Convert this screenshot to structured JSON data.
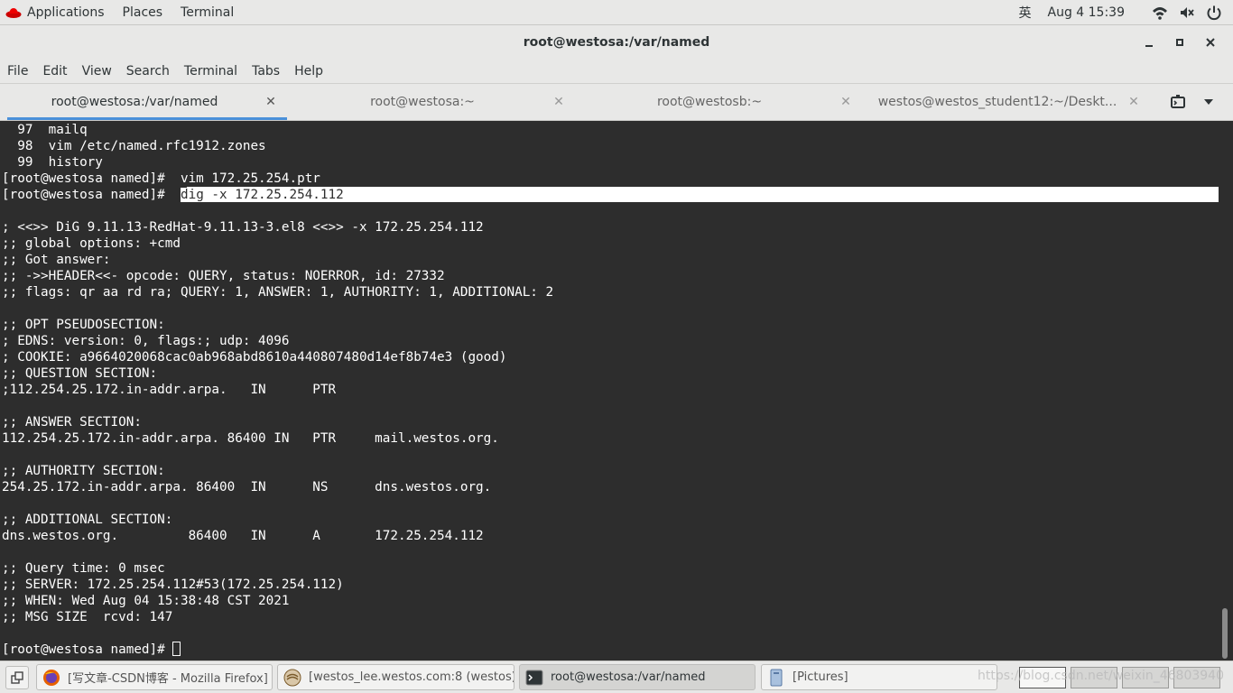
{
  "top_panel": {
    "applications": "Applications",
    "places": "Places",
    "terminal": "Terminal",
    "input_method": "英",
    "datetime": "Aug 4  15:39"
  },
  "window": {
    "title": "root@westosa:/var/named"
  },
  "menubar": {
    "items": [
      "File",
      "Edit",
      "View",
      "Search",
      "Terminal",
      "Tabs",
      "Help"
    ]
  },
  "tabs": [
    {
      "label": "root@westosa:/var/named",
      "active": true
    },
    {
      "label": "root@westosa:~",
      "active": false
    },
    {
      "label": "root@westosb:~",
      "active": false
    },
    {
      "label": "westos@westos_student12:~/Deskt...",
      "active": false
    }
  ],
  "terminal": {
    "lines": [
      "  97  mailq",
      "  98  vim /etc/named.rfc1912.zones",
      "  99  history",
      "[root@westosa named]#  vim 172.25.254.ptr",
      "[root@westosa named]#  ",
      "",
      "; <<>> DiG 9.11.13-RedHat-9.11.13-3.el8 <<>> -x 172.25.254.112",
      ";; global options: +cmd",
      ";; Got answer:",
      ";; ->>HEADER<<- opcode: QUERY, status: NOERROR, id: 27332",
      ";; flags: qr aa rd ra; QUERY: 1, ANSWER: 1, AUTHORITY: 1, ADDITIONAL: 2",
      "",
      ";; OPT PSEUDOSECTION:",
      "; EDNS: version: 0, flags:; udp: 4096",
      "; COOKIE: a9664020068cac0ab968abd8610a440807480d14ef8b74e3 (good)",
      ";; QUESTION SECTION:",
      ";112.254.25.172.in-addr.arpa.   IN      PTR",
      "",
      ";; ANSWER SECTION:",
      "112.254.25.172.in-addr.arpa. 86400 IN   PTR     mail.westos.org.",
      "",
      ";; AUTHORITY SECTION:",
      "254.25.172.in-addr.arpa. 86400  IN      NS      dns.westos.org.",
      "",
      ";; ADDITIONAL SECTION:",
      "dns.westos.org.         86400   IN      A       172.25.254.112",
      "",
      ";; Query time: 0 msec",
      ";; SERVER: 172.25.254.112#53(172.25.254.112)",
      ";; WHEN: Wed Aug 04 15:38:48 CST 2021",
      ";; MSG SIZE  rcvd: 147",
      "",
      "[root@westosa named]# "
    ],
    "highlighted_command": "dig -x 172.25.254.112"
  },
  "taskbar": {
    "windows": [
      {
        "label": "[写文章-CSDN博客 - Mozilla Firefox]",
        "icon": "firefox-icon"
      },
      {
        "label": "[westos_lee.westos.com:8 (westos)...",
        "icon": "vnc-viewer-icon"
      },
      {
        "label": "root@westosa:/var/named",
        "icon": "terminal-icon",
        "active": true
      },
      {
        "label": "[Pictures]",
        "icon": "file-manager-icon"
      }
    ],
    "watermark": "https://blog.csdn.net/weixin_46803940"
  },
  "colors": {
    "terminal_bg": "#2d2d2d",
    "terminal_fg": "#ffffff",
    "active_tab_underline": "#4a90d9",
    "panel_bg": "#e8e8e7"
  }
}
